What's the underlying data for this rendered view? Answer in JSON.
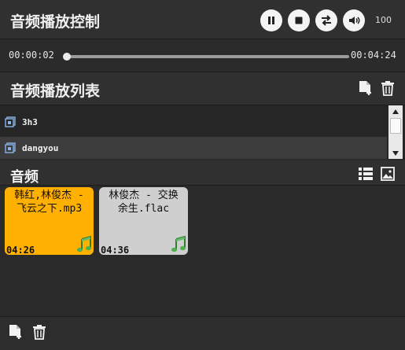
{
  "controls": {
    "title": "音频播放控制",
    "buttons": [
      "pause-icon",
      "stop-icon",
      "loop-icon",
      "volume-icon"
    ],
    "volume": "100"
  },
  "progress": {
    "current": "00:00:02",
    "total": "00:04:24",
    "fraction": 0.008
  },
  "playlist": {
    "title": "音频播放列表",
    "actions": [
      "add-file-icon",
      "trash-icon"
    ],
    "items": [
      {
        "label": "3h3",
        "selected": false
      },
      {
        "label": "dangyou",
        "selected": true
      }
    ]
  },
  "audio": {
    "title": "音频",
    "view_icons": [
      "list-view-icon",
      "image-view-icon"
    ],
    "cards": [
      {
        "name": "韩红,林俊杰 -\n飞云之下.mp3",
        "duration": "04:26",
        "color": "#ffb000"
      },
      {
        "name": "林俊杰 - 交换\n余生.flac",
        "duration": "04:36",
        "color": "#cfcfcf"
      }
    ]
  },
  "footer": {
    "actions": [
      "add-file-icon",
      "trash-icon"
    ]
  },
  "colors": {
    "background": "#2a2a2a",
    "header": "#303030",
    "selected_card": "#ffb000",
    "card": "#cfcfcf",
    "note_green": "#4caf50"
  }
}
